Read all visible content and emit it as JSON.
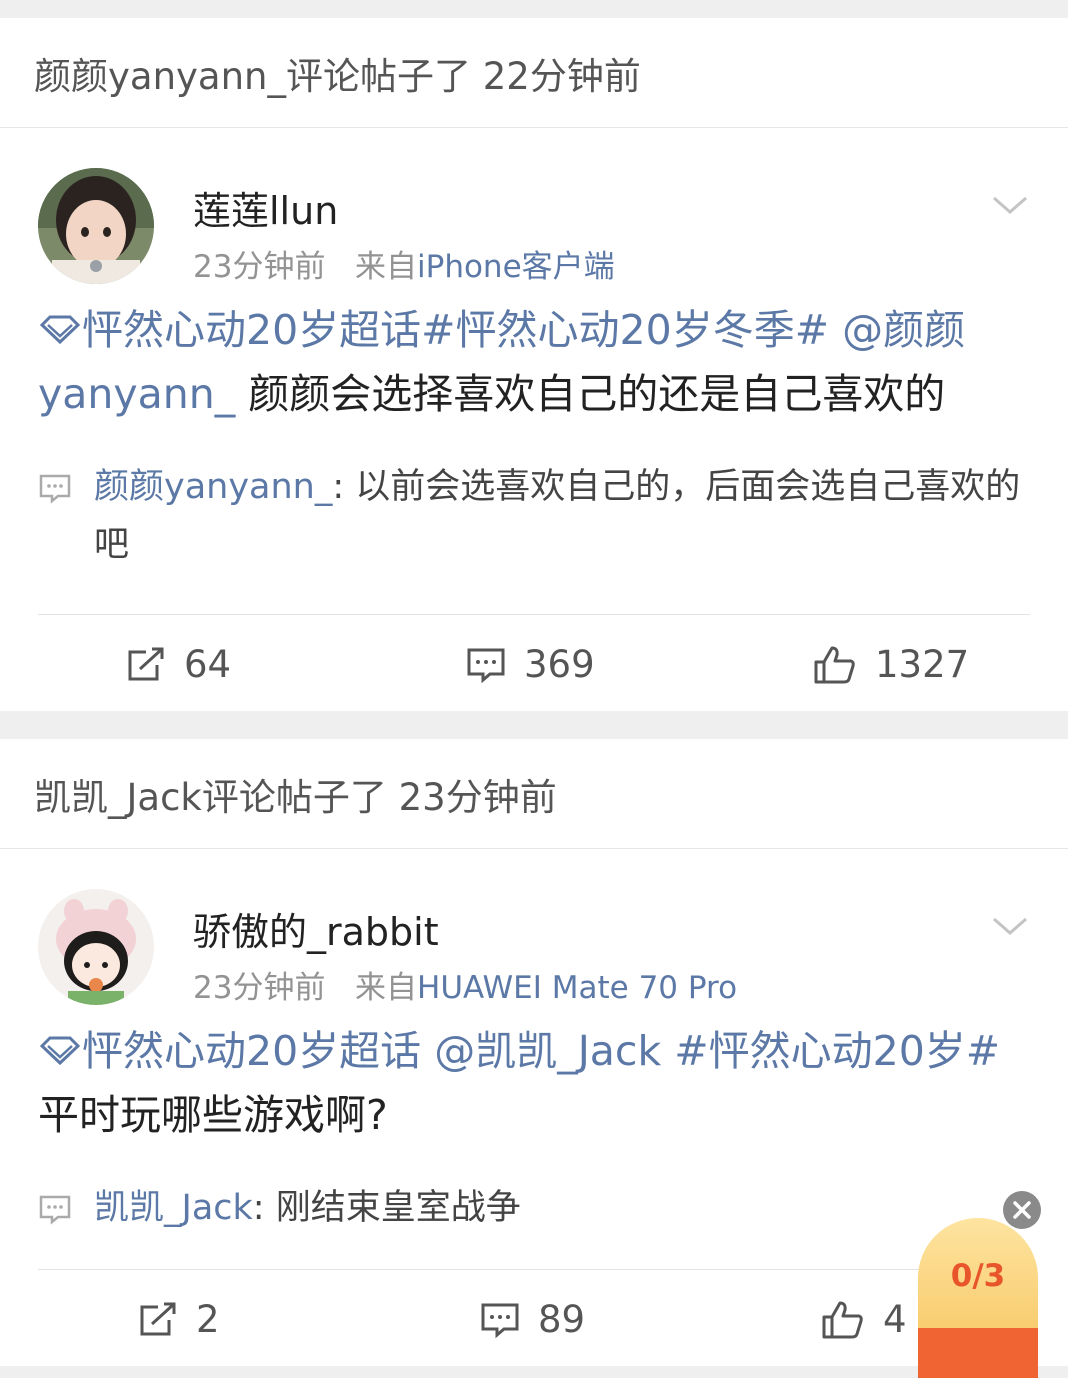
{
  "feed": [
    {
      "activity": "颜颜yanyann_评论帖子了 22分钟前",
      "author": "莲莲llun",
      "time": "23分钟前",
      "from_prefix": "来自",
      "from_device": "iPhone客户端",
      "content": {
        "topic": "怦然心动20岁超话",
        "hashtag": "#怦然心动20岁冬季#",
        "mention": "@颜颜yanyann_",
        "text": "颜颜会选择喜欢自己的还是自己喜欢的"
      },
      "reply": {
        "name": "颜颜yanyann_",
        "text": ": 以前会选喜欢自己的，后面会选自己喜欢的吧"
      },
      "stats": {
        "repost": "64",
        "comment": "369",
        "like": "1327"
      }
    },
    {
      "activity": "凯凯_Jack评论帖子了 23分钟前",
      "author": "骄傲的_rabbit",
      "time": "23分钟前",
      "from_prefix": "来自",
      "from_device": "HUAWEI Mate 70 Pro",
      "content": {
        "topic": "怦然心动20岁超话",
        "mention": "@凯凯_Jack",
        "hashtag": "#怦然心动20岁#",
        "text": "平时玩哪些游戏啊?"
      },
      "reply": {
        "name": "凯凯_Jack",
        "text": ": 刚结束皇室战争"
      },
      "stats": {
        "repost": "2",
        "comment": "89",
        "like": "4"
      }
    }
  ],
  "floating": {
    "counter": "0/3"
  },
  "colors": {
    "link": "#5b78a6",
    "meta": "#939393",
    "badge": "#f7c25a"
  }
}
